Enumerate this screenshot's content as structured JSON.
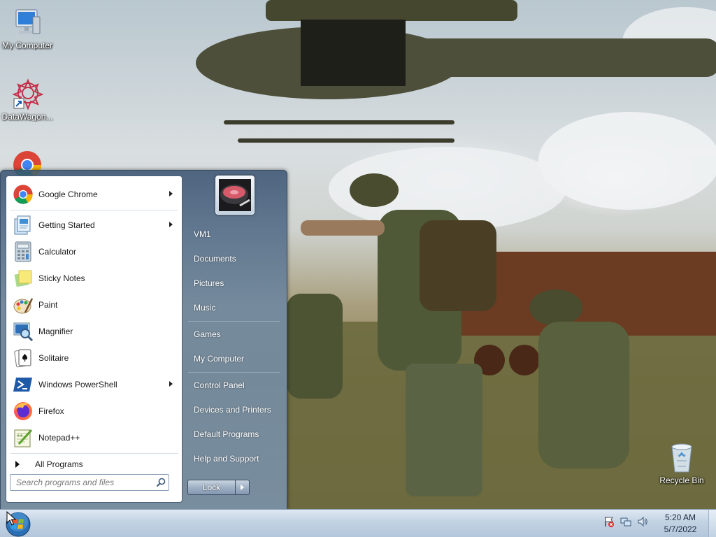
{
  "desktop": {
    "icons": [
      {
        "label": "My Computer",
        "icon": "computer-icon"
      },
      {
        "label": "DataWagon...",
        "icon": "datawagon-icon"
      },
      {
        "label": "",
        "icon": "chrome-icon"
      },
      {
        "label": "Recycle Bin",
        "icon": "recycle-bin-icon"
      }
    ]
  },
  "start_menu": {
    "programs": [
      {
        "label": "Google Chrome",
        "icon": "chrome-icon",
        "has_submenu": true
      },
      {
        "label": "Getting Started",
        "icon": "getting-started-icon",
        "has_submenu": true
      },
      {
        "label": "Calculator",
        "icon": "calculator-icon",
        "has_submenu": false
      },
      {
        "label": "Sticky Notes",
        "icon": "sticky-notes-icon",
        "has_submenu": false
      },
      {
        "label": "Paint",
        "icon": "paint-icon",
        "has_submenu": false
      },
      {
        "label": "Magnifier",
        "icon": "magnifier-icon",
        "has_submenu": false
      },
      {
        "label": "Solitaire",
        "icon": "solitaire-icon",
        "has_submenu": false
      },
      {
        "label": "Windows PowerShell",
        "icon": "powershell-icon",
        "has_submenu": true
      },
      {
        "label": "Firefox",
        "icon": "firefox-icon",
        "has_submenu": false
      },
      {
        "label": "Notepad++",
        "icon": "notepadpp-icon",
        "has_submenu": false
      }
    ],
    "all_programs_label": "All Programs",
    "search_placeholder": "Search programs and files",
    "right_items": [
      {
        "label": "VM1"
      },
      {
        "label": "Documents"
      },
      {
        "label": "Pictures"
      },
      {
        "label": "Music"
      },
      {
        "label": "Games"
      },
      {
        "label": "My Computer"
      },
      {
        "label": "Control Panel"
      },
      {
        "label": "Devices and Printers"
      },
      {
        "label": "Default Programs"
      },
      {
        "label": "Help and Support"
      }
    ],
    "lock_label": "Lock"
  },
  "taskbar": {
    "time": "5:20 AM",
    "date": "5/7/2022",
    "tray_icons": [
      "action-center-icon",
      "network-icon",
      "volume-icon"
    ]
  },
  "colors": {
    "menu_glass": "#5a7896",
    "taskbar": "#c2d2e3",
    "menu_left_bg": "#ffffff"
  }
}
